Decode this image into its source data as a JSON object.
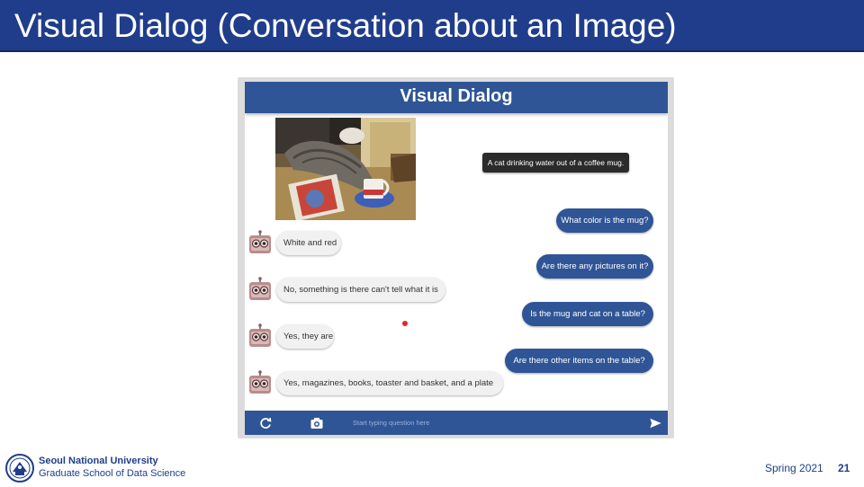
{
  "slide": {
    "title": "Visual Dialog (Conversation about an Image)",
    "footer": {
      "university": "Seoul National University",
      "school": "Graduate School of Data Science",
      "term": "Spring 2021",
      "page_number": "21"
    }
  },
  "app": {
    "title": "Visual Dialog",
    "caption": "A cat drinking water out of a coffee mug.",
    "questions": [
      "What color is the mug?",
      "Are there any pictures on it?",
      "Is the mug and cat on a table?",
      "Are there other items on the table?"
    ],
    "answers": [
      "White and red",
      "No, something is there can't tell what it is",
      "Yes, they are",
      "Yes, magazines, books, toaster and basket, and a plate"
    ],
    "composer": {
      "placeholder": "Start typing question here",
      "icons": [
        "refresh-icon",
        "camera-icon",
        "send-icon"
      ]
    }
  },
  "colors": {
    "slide_header": "#1f3d8a",
    "app_accent": "#2f5596",
    "answer_bubble": "#f1f1f1",
    "caption_tag": "#2b2b2b",
    "pointer_dot": "#e0282e"
  }
}
